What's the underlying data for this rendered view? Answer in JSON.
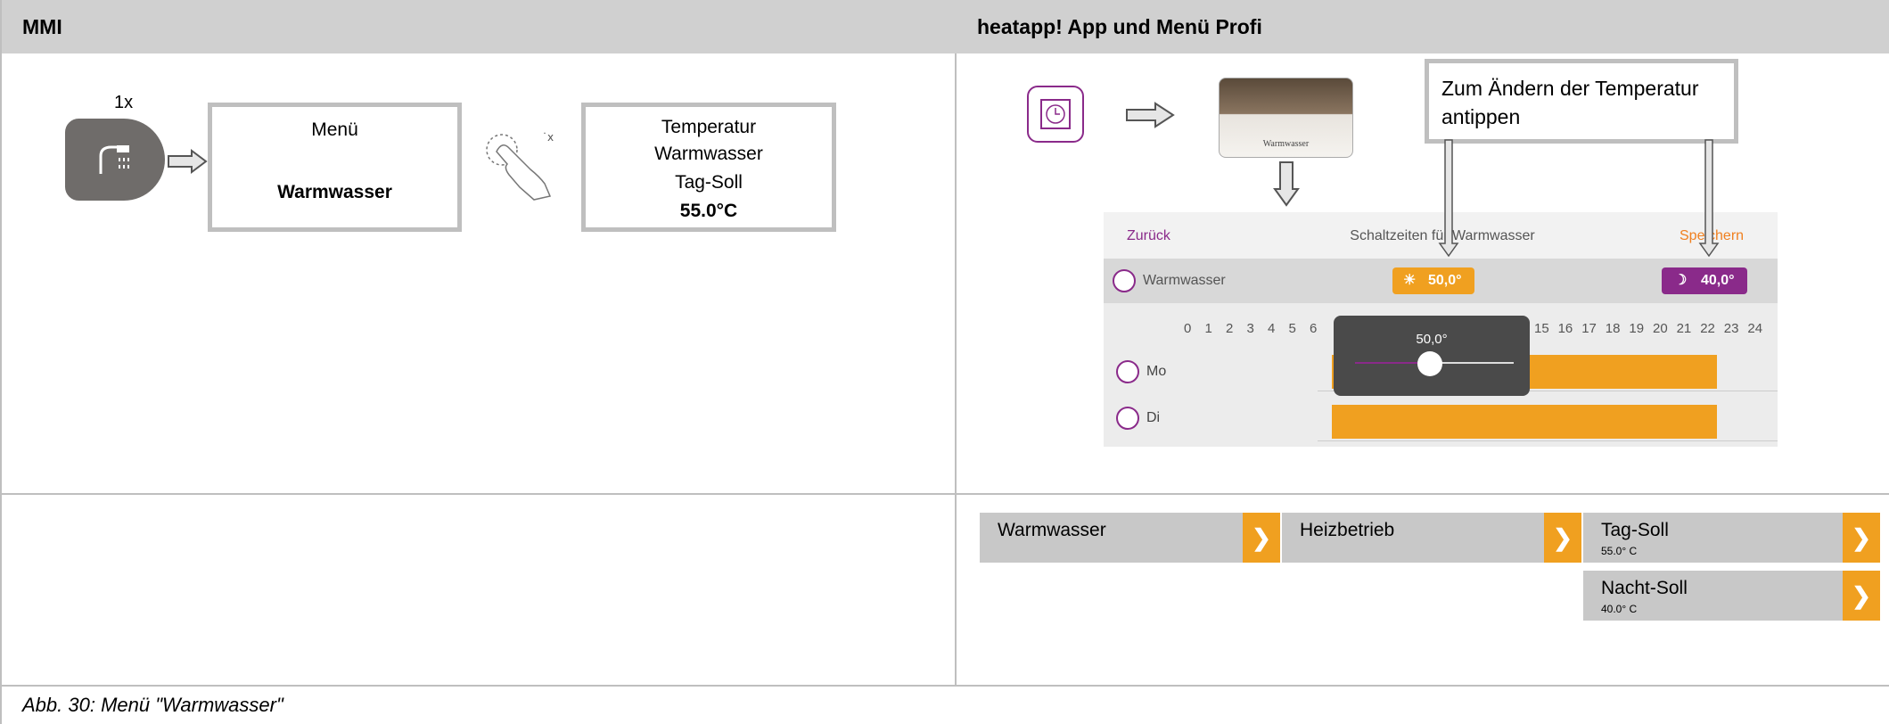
{
  "header": {
    "left_title": "MMI",
    "right_title": "heatapp!  App und Menü Profi"
  },
  "mmi": {
    "press_count": "1x",
    "box1": {
      "line1": "Menü",
      "line2": "Warmwasser"
    },
    "box2": {
      "line1": "Temperatur",
      "line2": "Warmwasser",
      "line3": "Tag-Soll",
      "line4": "55.0°C"
    }
  },
  "app": {
    "tile_label": "Warmwasser",
    "callout_text": "Zum Ändern der Temperatur antippen",
    "screen": {
      "back_label": "Zurück",
      "title": "Schaltzeiten für Warmwasser",
      "save_label": "Speichern",
      "zone_label": "Warmwasser",
      "day_temp": "50,0°",
      "night_temp": "40,0°",
      "slider_value": "50,0°",
      "hours": [
        "0",
        "1",
        "2",
        "3",
        "4",
        "5",
        "6",
        "15",
        "16",
        "17",
        "18",
        "19",
        "20",
        "21",
        "22",
        "23",
        "24"
      ],
      "days": [
        "Mo",
        "Di"
      ]
    }
  },
  "menu": {
    "items": [
      {
        "label": "Warmwasser",
        "sub": ""
      },
      {
        "label": "Heizbetrieb",
        "sub": ""
      },
      {
        "label": "Tag-Soll",
        "sub": "55.0° C"
      },
      {
        "label": "Nacht-Soll",
        "sub": "40.0° C"
      }
    ],
    "chevron": "❯"
  },
  "caption": "Abb. 30: Menü \"Warmwasser\"",
  "colors": {
    "accent": "#f0a020",
    "purple": "#8a2a8a",
    "header_bg": "#d0d0d0",
    "border": "#bfbfbf"
  }
}
